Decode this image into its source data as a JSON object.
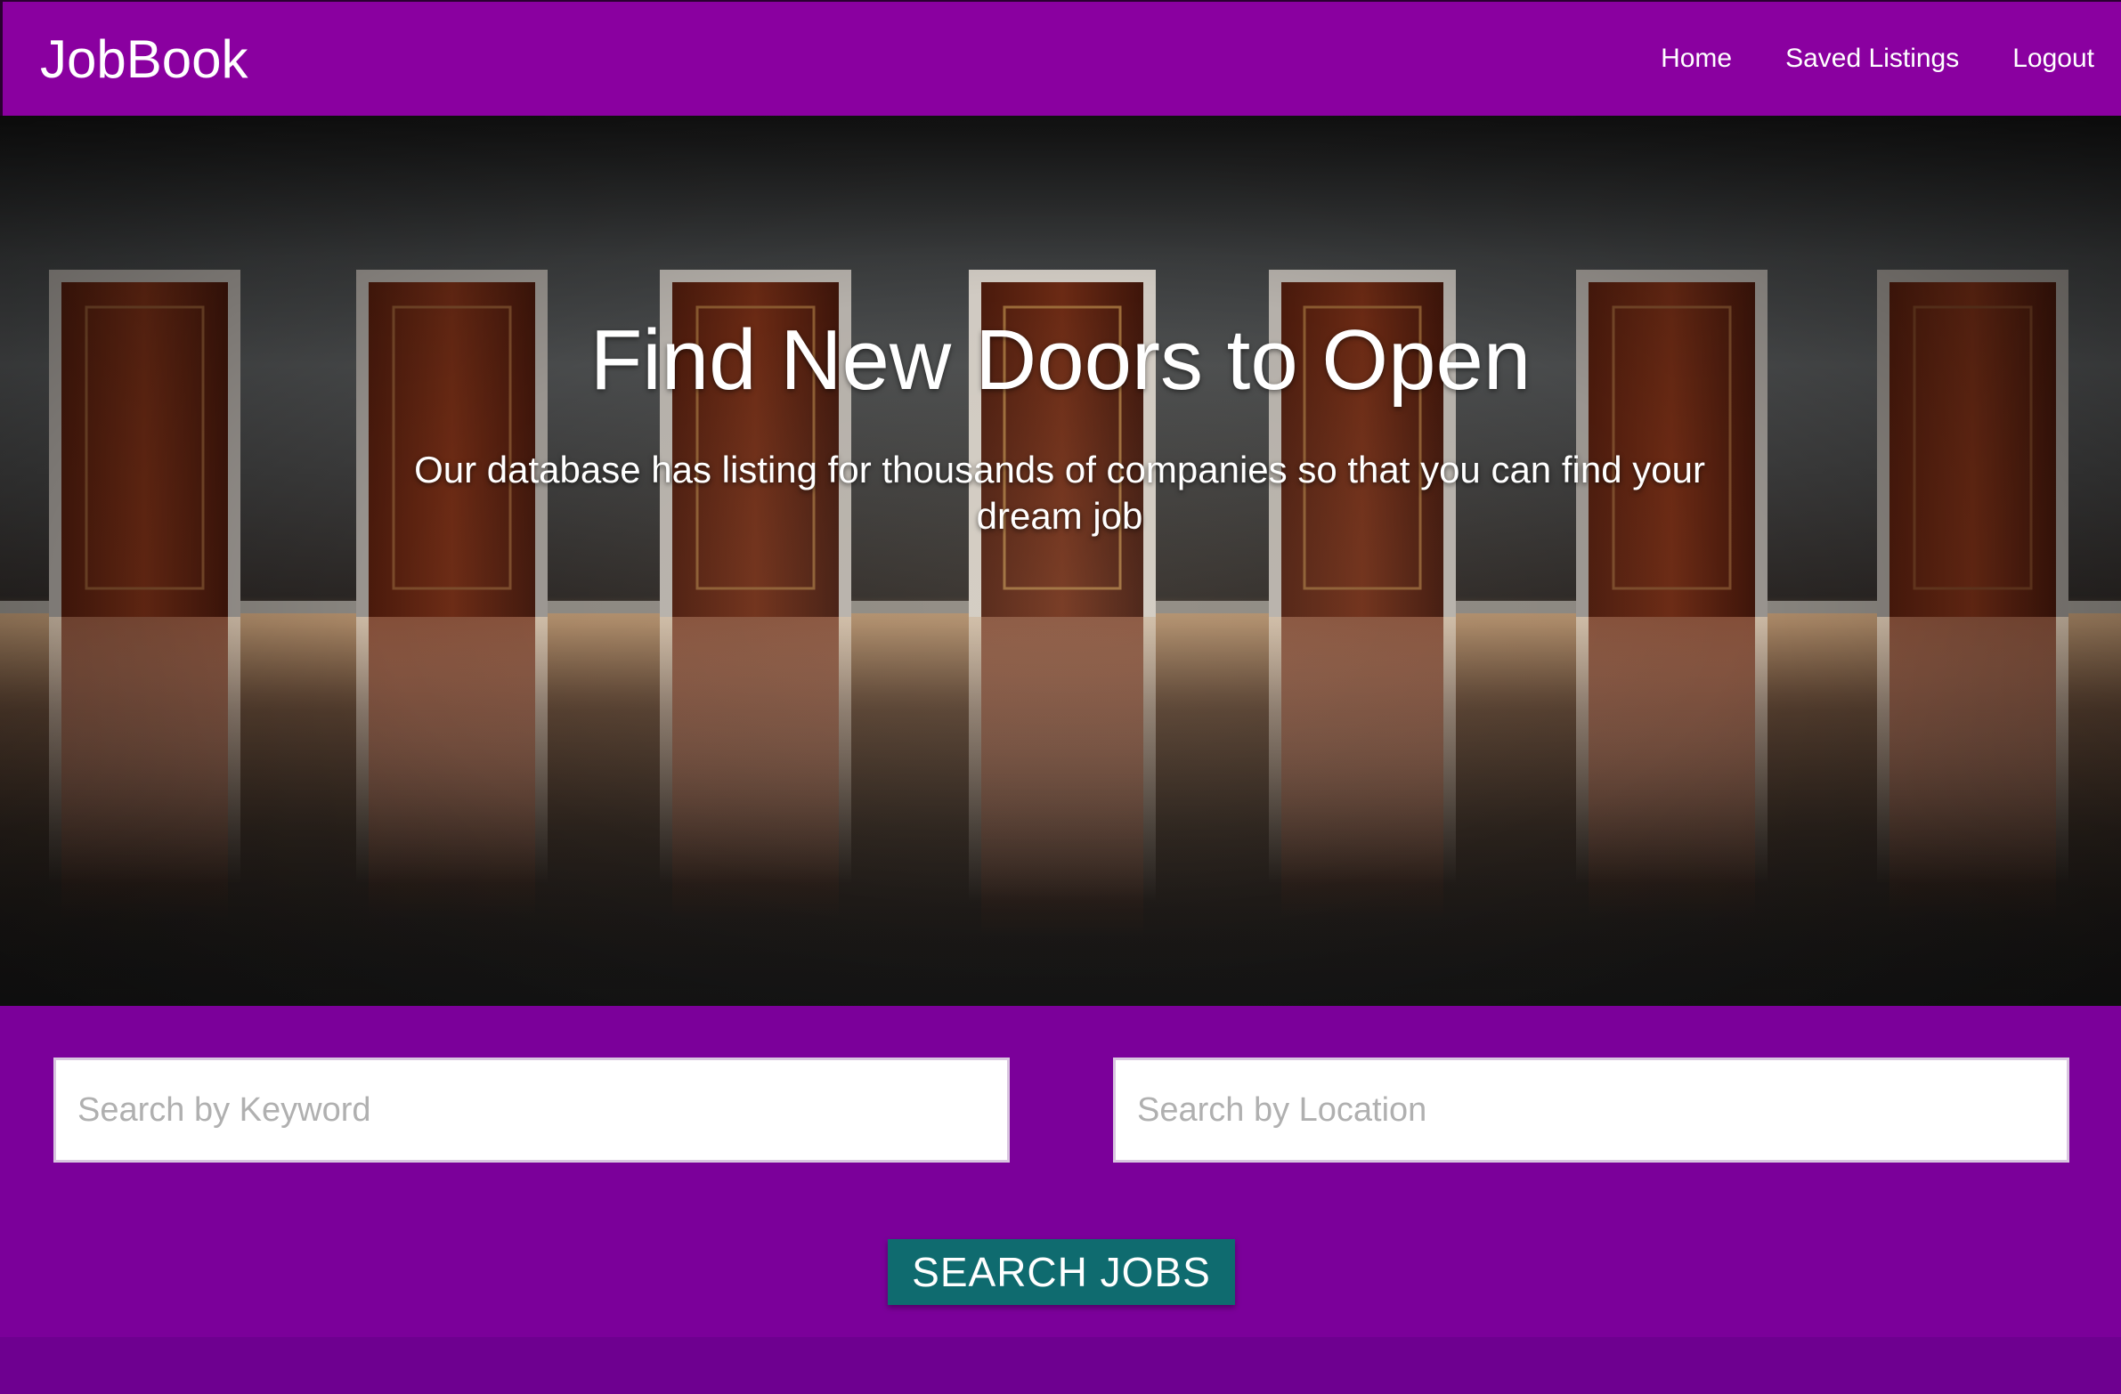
{
  "navbar": {
    "brand": "JobBook",
    "links": [
      "Home",
      "Saved Listings",
      "Logout"
    ]
  },
  "hero": {
    "title": "Find New Doors to Open",
    "subtitle": "Our database has listing for thousands of companies so that you can find your dream job"
  },
  "search": {
    "keyword_placeholder": "Search by Keyword",
    "location_placeholder": "Search by Location",
    "button_label": "SEARCH JOBS"
  },
  "colors": {
    "navbar": "#8a00a0",
    "panel": "#7b009a",
    "button": "#0f6b6f"
  }
}
